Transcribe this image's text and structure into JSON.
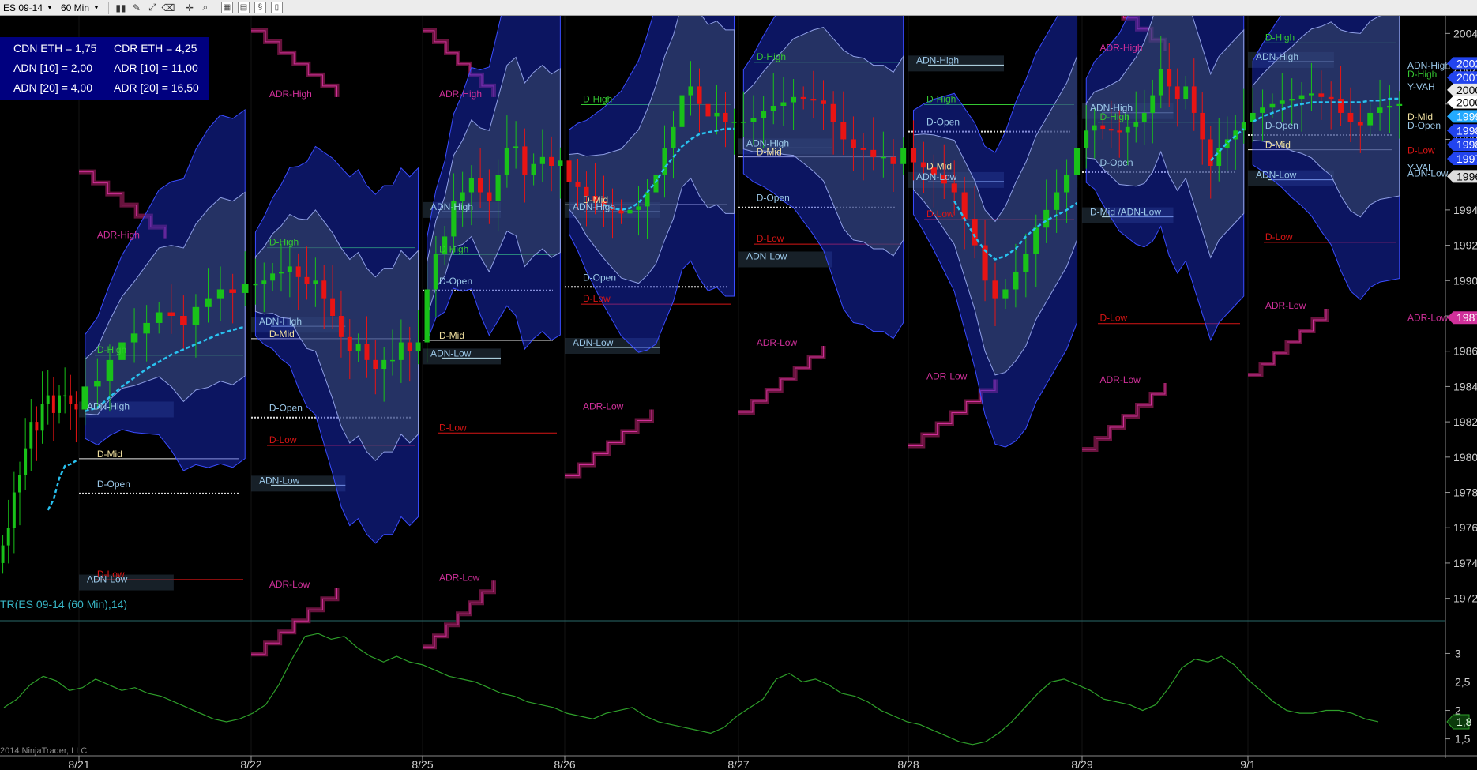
{
  "toolbar": {
    "instrument": "ES 09-14",
    "interval": "60 Min",
    "buttons": [
      {
        "name": "bars-style-icon",
        "glyph": "▮▮"
      },
      {
        "name": "draw-pencil-icon",
        "glyph": "✎"
      },
      {
        "name": "draw-tools-icon",
        "glyph": "⤢"
      },
      {
        "name": "eraser-icon",
        "glyph": "⌫"
      },
      {
        "name": "crosshair-icon",
        "glyph": "✛"
      },
      {
        "name": "zoom-icon",
        "glyph": "⌕"
      },
      {
        "name": "indicators-icon",
        "glyph": "▦"
      },
      {
        "name": "strategies-icon",
        "glyph": "▤"
      },
      {
        "name": "script-icon",
        "glyph": "§"
      },
      {
        "name": "properties-icon",
        "glyph": "▯"
      }
    ]
  },
  "info_box": [
    [
      "CDN ETH = 1,75",
      "CDR ETH = 4,25"
    ],
    [
      "ADN [10] = 2,00",
      "ADR [10] = 11,00"
    ],
    [
      "ADN [20] = 4,00",
      "ADR [20] = 16,50"
    ]
  ],
  "indicator_title": "TR(ES 09-14 (60 Min),14)",
  "copyright": "2014 NinjaTrader, LLC",
  "colors": {
    "background": "#000000",
    "bull": "#19c219",
    "bear": "#e81414",
    "vwap": "#29c2f0",
    "adr": "#7a1648",
    "adr_text": "#d0309a",
    "band": "#1a2fd6",
    "d_high": "#35c832",
    "d_low": "#d81515",
    "adn_text": "#9cc8e8",
    "indicator": "#2e9f2a"
  },
  "chart_data": {
    "type": "candlestick",
    "instrument": "ES 09-14",
    "interval": "60 Min",
    "price_axis": {
      "min": 1971,
      "max": 2005,
      "ticks": [
        "1972,0",
        "1974,0",
        "1976,0",
        "1978,0",
        "1980,0",
        "1982,0",
        "1984,0",
        "1986,0",
        "1988,0",
        "1990,0",
        "1992,0",
        "1994,0",
        "1996,0",
        "1998,0",
        "2000,0",
        "2002,0",
        "2004,0"
      ]
    },
    "dates": [
      "8/21",
      "8/22",
      "8/25",
      "8/26",
      "8/27",
      "8/28",
      "8/29",
      "9/1"
    ],
    "closes": [
      1975.0,
      1976.0,
      1978.0,
      1979.0,
      1980.5,
      1982.0,
      1981.5,
      1983.0,
      1983.5,
      1982.5,
      1983.5,
      1983.5,
      1983.0,
      1982.7,
      1984.0,
      1984.3,
      1985.5,
      1986.5,
      1987.0,
      1987.6,
      1988.2,
      1988.0,
      1987.5,
      1988.5,
      1989.0,
      1989.5,
      1989.3,
      1989.8,
      1989.8,
      1990.0,
      1990.4,
      1990.5,
      1990.8,
      1990.2,
      1989.8,
      1990.0,
      1989.0,
      1988.0,
      1986.8,
      1986.0,
      1986.4,
      1985.5,
      1985.0,
      1985.5,
      1985.5,
      1986.5,
      1986.0,
      1986.5,
      1989.5,
      1991.5,
      1992.5,
      1994.5,
      1995.0,
      1995.8,
      1995.0,
      1994.5,
      1996.0,
      1997.5,
      1997.6,
      1996.0,
      1996.6,
      1997.0,
      1996.5,
      1996.8,
      1995.6,
      1995.3,
      1994.8,
      1994.5,
      1994.2,
      1994.0,
      1993.8,
      1994.0,
      1994.2,
      1995.0,
      1996.0,
      1997.5,
      1998.7,
      2000.5,
      2001.0,
      2000.0,
      1999.3,
      1999.5,
      1999.0,
      1999.0,
      1999.0,
      1999.2,
      1999.6,
      1999.9,
      2000.1,
      2000.4,
      2000.3,
      2000.2,
      2000.0,
      1999.0,
      1998.0,
      1997.5,
      1997.4,
      1997.0,
      1997.0,
      1996.6,
      1997.5,
      1996.7,
      1996.4,
      1996.0,
      1995.5,
      1995.0,
      1993.5,
      1992.0,
      1990.0,
      1989.0,
      1989.5,
      1990.5,
      1991.5,
      1993.0,
      1994.0,
      1995.0,
      1996.0,
      1997.5,
      1998.5,
      1998.8,
      1998.6,
      1998.5,
      1998.4,
      1998.7,
      1999.0,
      1999.5,
      2000.5,
      2002.0,
      2001.0,
      2000.3,
      2001.0,
      1999.5,
      1998.0,
      1996.5,
      1997.5,
      1998.0,
      1998.5,
      1999.0,
      1999.5,
      1999.8,
      2000.0,
      2000.2,
      2000.3,
      2000.5,
      2000.6,
      2000.4,
      2000.3,
      1999.5,
      1999.0,
      1998.8,
      1999.5,
      1999.8,
      1999.9,
      2000.0
    ],
    "vwap": [
      null,
      null,
      null,
      null,
      null,
      null,
      null,
      null,
      1977.0,
      1977.6,
      1978.8,
      1979.5,
      1979.6,
      1979.8,
      1982.6,
      1982.8,
      1983.4,
      1984.0,
      1984.5,
      1985.0,
      1985.4,
      1985.8,
      1986.1,
      1986.4,
      1986.7,
      1987.0,
      1987.2,
      1987.4,
      null,
      null,
      null,
      null,
      null,
      null,
      null,
      null,
      null,
      null,
      null,
      null,
      null,
      null,
      null,
      null,
      null,
      null,
      null,
      null,
      null,
      null,
      null,
      null,
      null,
      null,
      null,
      null,
      null,
      null,
      null,
      null,
      null,
      null,
      null,
      null,
      null,
      null,
      null,
      null,
      1994.3,
      1994.1,
      1994.0,
      1994.1,
      1994.4,
      1995.0,
      1995.6,
      1996.4,
      1997.0,
      1997.6,
      1998.0,
      1998.3,
      1998.4,
      1998.5,
      1998.6,
      1998.6,
      null,
      null,
      null,
      null,
      null,
      null,
      null,
      null,
      null,
      null,
      null,
      null,
      null,
      null,
      null,
      null,
      null,
      null,
      null,
      null,
      null,
      1994.5,
      1993.5,
      1992.5,
      1991.7,
      1991.2,
      1991.4,
      1991.8,
      1992.5,
      1993.0,
      1993.4,
      1993.7,
      1994.0,
      1994.4,
      null,
      null,
      null,
      null,
      null,
      null,
      null,
      null,
      null,
      null,
      null,
      null,
      null,
      null,
      null,
      1996.8,
      1997.3,
      1997.8,
      1998.2,
      1998.6,
      1999.0,
      1999.3,
      1999.5,
      1999.7,
      1999.9,
      2000.0,
      2000.1,
      2000.1,
      2000.1,
      2000.1,
      2000.1,
      2000.1,
      2000.2,
      2000.2,
      2000.3,
      2000.3
    ],
    "level_labels": [
      {
        "text": "ADR-High",
        "kind": "adr",
        "x": 0,
        "y": 1992.4
      },
      {
        "text": "D-High",
        "kind": "dhigh",
        "x": 0,
        "y": 1985.9
      },
      {
        "text": "ADN-High",
        "kind": "adn",
        "x": 0,
        "y": 1982.7
      },
      {
        "text": "D-Mid",
        "kind": "dmid",
        "x": 0,
        "y": 1980.0
      },
      {
        "text": "D-Open",
        "kind": "adn",
        "x": 0,
        "y": 1978.3
      },
      {
        "text": "D-Low",
        "kind": "dlow",
        "x": 0,
        "y": 1973.2
      },
      {
        "text": "ADN-Low",
        "kind": "adn",
        "x": 0,
        "y": 1972.9
      },
      {
        "text": "ADR-High",
        "kind": "adr",
        "x": 1,
        "y": 2000.4
      },
      {
        "text": "D-High",
        "kind": "dhigh",
        "x": 1,
        "y": 1992.0
      },
      {
        "text": "ADN-High",
        "kind": "adn",
        "x": 1,
        "y": 1987.5
      },
      {
        "text": "D-Mid",
        "kind": "dmid",
        "x": 1,
        "y": 1986.8
      },
      {
        "text": "D-Open",
        "kind": "adn",
        "x": 1,
        "y": 1982.6
      },
      {
        "text": "D-Low",
        "kind": "dlow",
        "x": 1,
        "y": 1980.8
      },
      {
        "text": "ADN-Low",
        "kind": "adn",
        "x": 1,
        "y": 1978.5
      },
      {
        "text": "ADR-Low",
        "kind": "adr",
        "x": 1,
        "y": 1972.6
      },
      {
        "text": "ADR-High",
        "kind": "adr",
        "x": 2,
        "y": 2000.4
      },
      {
        "text": "ADN-High",
        "kind": "adn",
        "x": 2,
        "y": 1994.0
      },
      {
        "text": "D-High",
        "kind": "dhigh",
        "x": 2,
        "y": 1991.6
      },
      {
        "text": "D-Open",
        "kind": "adn",
        "x": 2,
        "y": 1989.8
      },
      {
        "text": "D-Mid",
        "kind": "dmid",
        "x": 2,
        "y": 1986.7
      },
      {
        "text": "ADN-Low",
        "kind": "adn",
        "x": 2,
        "y": 1985.7
      },
      {
        "text": "D-Low",
        "kind": "dlow",
        "x": 2,
        "y": 1981.5
      },
      {
        "text": "ADR-Low",
        "kind": "adr",
        "x": 2,
        "y": 1973.0
      },
      {
        "text": "D-High",
        "kind": "dhigh",
        "x": 3,
        "y": 2000.1
      },
      {
        "text": "D-Mid",
        "kind": "dmid",
        "x": 3,
        "y": 1994.4
      },
      {
        "text": "ADN-High",
        "kind": "adn",
        "x": 3,
        "y": 1994.0
      },
      {
        "text": "D-Open",
        "kind": "adn",
        "x": 3,
        "y": 1990.0
      },
      {
        "text": "D-Low",
        "kind": "dlow",
        "x": 3,
        "y": 1988.8
      },
      {
        "text": "ADN-Low",
        "kind": "adn",
        "x": 3,
        "y": 1986.3
      },
      {
        "text": "ADR-Low",
        "kind": "adr",
        "x": 3,
        "y": 1982.7
      },
      {
        "text": "D-High",
        "kind": "dhigh",
        "x": 4,
        "y": 2002.5
      },
      {
        "text": "ADN-High",
        "kind": "adn",
        "x": 4,
        "y": 1997.6
      },
      {
        "text": "D-Mid",
        "kind": "dmid",
        "x": 4,
        "y": 1997.1
      },
      {
        "text": "D-Open",
        "kind": "adn",
        "x": 4,
        "y": 1994.5
      },
      {
        "text": "D-Low",
        "kind": "dlow",
        "x": 4,
        "y": 1992.2
      },
      {
        "text": "ADN-Low",
        "kind": "adn",
        "x": 4,
        "y": 1991.2
      },
      {
        "text": "ADR-Low",
        "kind": "adr",
        "x": 4,
        "y": 1986.3
      },
      {
        "text": "ADN-High",
        "kind": "adn",
        "x": 5,
        "y": 2002.3
      },
      {
        "text": "D-High",
        "kind": "dhigh",
        "x": 5,
        "y": 2000.1
      },
      {
        "text": "D-Open",
        "kind": "adn",
        "x": 5,
        "y": 1998.8
      },
      {
        "text": "D-Mid",
        "kind": "dmid",
        "x": 5,
        "y": 1996.3
      },
      {
        "text": "ADN-Low",
        "kind": "adn",
        "x": 5,
        "y": 1995.7
      },
      {
        "text": "D-Low",
        "kind": "dlow",
        "x": 5,
        "y": 1993.6
      },
      {
        "text": "ADR-Low",
        "kind": "adr",
        "x": 5,
        "y": 1984.4
      },
      {
        "text": "ADR-High",
        "kind": "adr",
        "x": 6,
        "y": 2003.0
      },
      {
        "text": "ADN-High",
        "kind": "adn",
        "x": 6,
        "y": 1999.6
      },
      {
        "text": "D-High",
        "kind": "dhigh",
        "x": 6,
        "y": 1999.1
      },
      {
        "text": "D-Open",
        "kind": "adn",
        "x": 6,
        "y": 1996.5
      },
      {
        "text": "D-Mid /ADN-Low",
        "kind": "adn",
        "x": 6,
        "y": 1993.7
      },
      {
        "text": "D-Low",
        "kind": "dlow",
        "x": 6,
        "y": 1987.7
      },
      {
        "text": "ADR-Low",
        "kind": "adr",
        "x": 6,
        "y": 1984.2
      },
      {
        "text": "D-High",
        "kind": "dhigh",
        "x": 7,
        "y": 2003.6
      },
      {
        "text": "ADN-High",
        "kind": "adn",
        "x": 7,
        "y": 2002.5
      },
      {
        "text": "D-Open",
        "kind": "adn",
        "x": 7,
        "y": 1998.6
      },
      {
        "text": "D-Mid",
        "kind": "dmid",
        "x": 7,
        "y": 1997.5
      },
      {
        "text": "D-Low",
        "kind": "dlow",
        "x": 7,
        "y": 1992.3
      },
      {
        "text": "ADN-Low",
        "kind": "adn",
        "x": 7,
        "y": 1995.8
      },
      {
        "text": "ADR-Low",
        "kind": "adr",
        "x": 7,
        "y": 1988.4
      }
    ],
    "right_labels": [
      {
        "text": "ADN-High",
        "kind": "adn",
        "y": 2002.0
      },
      {
        "text": "D-High",
        "kind": "dhigh",
        "y": 2001.5
      },
      {
        "text": "Y-VAH",
        "kind": "adn",
        "y": 2000.8
      },
      {
        "text": "D-Mid",
        "kind": "dmid",
        "y": 1999.1
      },
      {
        "text": "D-Open",
        "kind": "adn",
        "y": 1998.6
      },
      {
        "text": "D-Low",
        "kind": "dlow",
        "y": 1997.2
      },
      {
        "text": "Y-VAL",
        "kind": "adn",
        "y": 1996.2
      },
      {
        "text": "ADN-Low",
        "kind": "adn",
        "y": 1995.9
      },
      {
        "text": "ADR-Low",
        "kind": "adr",
        "y": 1987.7
      }
    ],
    "price_tags": [
      {
        "text": "2002",
        "y": 2002.3,
        "color": "#2244ee"
      },
      {
        "text": "2001",
        "y": 2001.5,
        "color": "#2244ee"
      },
      {
        "text": "2000",
        "y": 2000.8,
        "color": "#e8e8e8"
      },
      {
        "text": "2000",
        "y": 2000.1,
        "color": "#ffffff"
      },
      {
        "text": "1999",
        "y": 1999.3,
        "color": "#22aaff"
      },
      {
        "text": "1998",
        "y": 1998.5,
        "color": "#2244ee"
      },
      {
        "text": "1998",
        "y": 1997.7,
        "color": "#2244ee"
      },
      {
        "text": "1997",
        "y": 1996.9,
        "color": "#2244ee"
      },
      {
        "text": "1996",
        "y": 1995.9,
        "color": "#dddddd"
      },
      {
        "text": "1987",
        "y": 1987.9,
        "color": "#d0309a"
      }
    ],
    "indicator": {
      "title": "TR(ES 09-14 (60 Min),14)",
      "min": 1.3,
      "max": 3.45,
      "ticks": [
        "1,5",
        "2",
        "2,5",
        "3"
      ],
      "last": "1,8",
      "values": [
        2.05,
        2.2,
        2.45,
        2.6,
        2.52,
        2.35,
        2.4,
        2.55,
        2.45,
        2.35,
        2.4,
        2.3,
        2.25,
        2.15,
        2.05,
        1.95,
        1.85,
        1.8,
        1.85,
        1.95,
        2.1,
        2.45,
        2.9,
        3.3,
        3.35,
        3.25,
        3.3,
        3.1,
        2.95,
        2.85,
        2.95,
        2.85,
        2.8,
        2.7,
        2.6,
        2.55,
        2.5,
        2.4,
        2.3,
        2.25,
        2.15,
        2.1,
        2.05,
        1.95,
        1.9,
        1.85,
        1.95,
        2.0,
        2.05,
        1.9,
        1.8,
        1.75,
        1.7,
        1.65,
        1.6,
        1.7,
        1.9,
        2.05,
        2.2,
        2.55,
        2.65,
        2.5,
        2.55,
        2.45,
        2.3,
        2.25,
        2.15,
        2.0,
        1.9,
        1.8,
        1.75,
        1.65,
        1.55,
        1.45,
        1.4,
        1.45,
        1.6,
        1.8,
        2.05,
        2.3,
        2.5,
        2.55,
        2.45,
        2.35,
        2.2,
        2.15,
        2.1,
        2.0,
        2.1,
        2.4,
        2.75,
        2.9,
        2.85,
        2.95,
        2.8,
        2.55,
        2.35,
        2.15,
        2.0,
        1.95,
        1.95,
        2.0,
        2.0,
        1.95,
        1.85,
        1.8
      ]
    }
  }
}
